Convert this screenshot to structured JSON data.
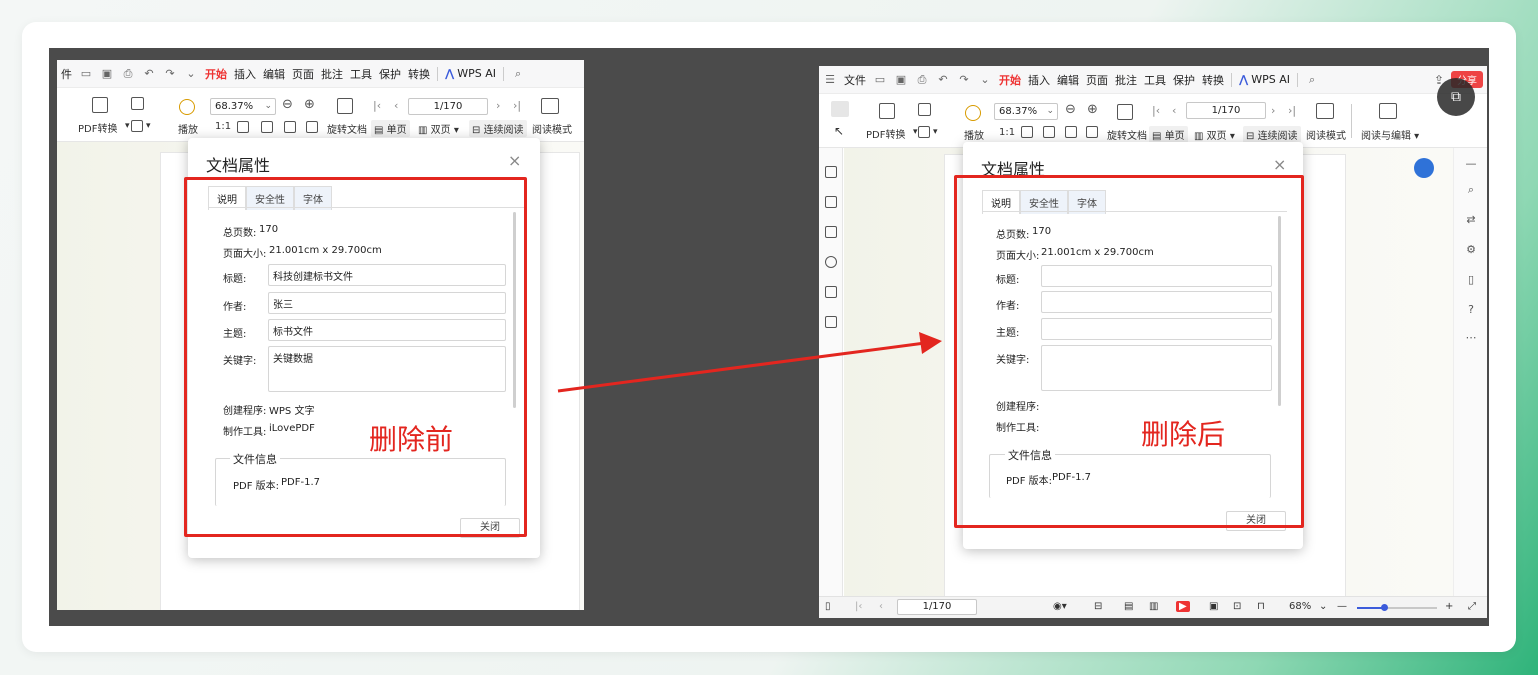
{
  "left": {
    "menu": [
      "件",
      "开始",
      "插入",
      "编辑",
      "页面",
      "批注",
      "工具",
      "保护",
      "转换"
    ],
    "wps_ai": "WPS AI",
    "toolbar": {
      "pdf_convert": "PDF转换",
      "play": "播放",
      "zoom": "68.37%",
      "page": "1/170",
      "rotate": "旋转文档",
      "single": "单页",
      "double": "双页",
      "continuous": "连续阅读",
      "reading": "阅读模式"
    },
    "dialog": {
      "title": "文档属性",
      "close_icon": "×",
      "tabs": [
        "说明",
        "安全性",
        "字体"
      ],
      "total_pages_label": "总页数:",
      "total_pages": "170",
      "page_size_label": "页面大小:",
      "page_size": "21.001cm x 29.700cm",
      "title_label": "标题:",
      "title_value": "科技创建标书文件",
      "author_label": "作者:",
      "author_value": "张三",
      "subject_label": "主题:",
      "subject_value": "标书文件",
      "keywords_label": "关键字:",
      "keywords_value": "关键数据",
      "creator_label": "创建程序:",
      "creator_value": "WPS 文字",
      "producer_label": "制作工具:",
      "producer_value": "iLovePDF",
      "file_info": "文件信息",
      "pdf_version_label": "PDF 版本:",
      "pdf_version": "PDF-1.7",
      "close_button": "关闭"
    },
    "caption": "删除前"
  },
  "right": {
    "menu": [
      "文件",
      "开始",
      "插入",
      "编辑",
      "页面",
      "批注",
      "工具",
      "保护",
      "转换"
    ],
    "wps_ai": "WPS AI",
    "share": "分享",
    "toolbar": {
      "pdf_convert": "PDF转换",
      "play": "播放",
      "zoom": "68.37%",
      "page": "1/170",
      "rotate": "旋转文档",
      "single": "单页",
      "double": "双页",
      "continuous": "连续阅读",
      "reading": "阅读模式",
      "read_edit": "阅读与编辑"
    },
    "dialog": {
      "title": "文档属性",
      "close_icon": "×",
      "tabs": [
        "说明",
        "安全性",
        "字体"
      ],
      "total_pages_label": "总页数:",
      "total_pages": "170",
      "page_size_label": "页面大小:",
      "page_size": "21.001cm x 29.700cm",
      "title_label": "标题:",
      "author_label": "作者:",
      "subject_label": "主题:",
      "keywords_label": "关键字:",
      "creator_label": "创建程序:",
      "producer_label": "制作工具:",
      "file_info": "文件信息",
      "pdf_version_label": "PDF 版本:",
      "pdf_version": "PDF-1.7",
      "close_button": "关闭"
    },
    "status": {
      "page": "1/170",
      "zoom": "68%"
    },
    "caption": "删除后"
  },
  "colors": {
    "accent_red": "#e3261f",
    "wps_blue": "#3b5bdb"
  }
}
